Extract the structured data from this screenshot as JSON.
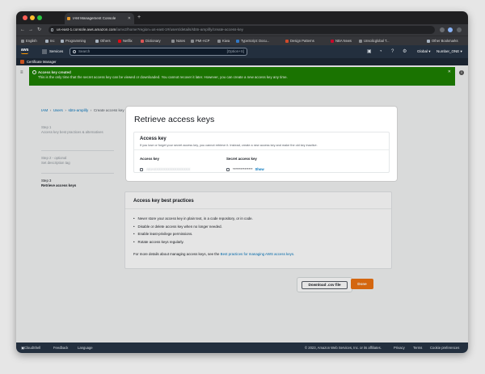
{
  "browser": {
    "tab_title": "IAM Management Console",
    "url_domain": "us-east-1.console.aws.amazon.com",
    "url_path": "/iamv2/home?region=us-east-1#/users/details/sbtn-amplify/create-access-key",
    "bookmarks": [
      "English",
      "Inc",
      "Programming",
      "Others",
      "Netflix",
      "Dictionary",
      "Notes",
      "PMI-ACP",
      "Kiwa",
      "TypeScript: Docu...",
      "Design Patterns",
      "NBA News",
      "Unsolicglobal T..."
    ],
    "other_bookmarks": "Other Bookmarks"
  },
  "aws_header": {
    "services_label": "Services",
    "search_placeholder": "Search",
    "search_shortcut": "[Option+S]",
    "region": "Global",
    "account": "Number_ONE",
    "favorite_service": "Certificate Manager"
  },
  "flash": {
    "title": "Access key created",
    "message": "This is the only time that the secret access key can be viewed or downloaded. You cannot recover it later. However, you can create a new access key any time."
  },
  "breadcrumb": {
    "items": [
      "IAM",
      "Users",
      "sbtn-amplify",
      "Create access key"
    ]
  },
  "steps": [
    {
      "step": "Step 1",
      "label": "Access key best practices & alternatives"
    },
    {
      "step": "Step 2 - optional",
      "label": "Set description tag"
    },
    {
      "step": "Step 3",
      "label": "Retrieve access keys"
    }
  ],
  "modal": {
    "title": "Retrieve access keys",
    "card_title": "Access key",
    "card_desc": "If you lose or forget your secret access key, you cannot retrieve it. Instead, create a new access key and make the old key inactive.",
    "col_access_key": "Access key",
    "col_secret_key": "Secret access key",
    "access_key_value": "AKIAXXXXXXXXXXXXXXXX",
    "secret_key_value": "***************",
    "show_label": "Show"
  },
  "best_practices": {
    "title": "Access key best practices",
    "items": [
      "Never store your access key in plain text, in a code repository, or in code.",
      "Disable or delete access key when no longer needed.",
      "Enable least-privilege permissions.",
      "Rotate access keys regularly."
    ],
    "more_prefix": "For more details about managing access keys, see the",
    "more_link": "Best practices for managing AWS access keys."
  },
  "actions": {
    "download_label": "Download .csv file",
    "done_label": "Done"
  },
  "footer": {
    "cloudshell": "CloudShell",
    "feedback": "Feedback",
    "language": "Language",
    "copyright": "© 2023, Amazon Web Services, Inc. or its affiliates.",
    "privacy": "Privacy",
    "terms": "Terms",
    "cookies": "Cookie preferences"
  },
  "colors": {
    "aws_nav": "#232f3e",
    "flash_success": "#1d8102",
    "primary_orange": "#ec7211",
    "link_blue": "#0073bb"
  }
}
